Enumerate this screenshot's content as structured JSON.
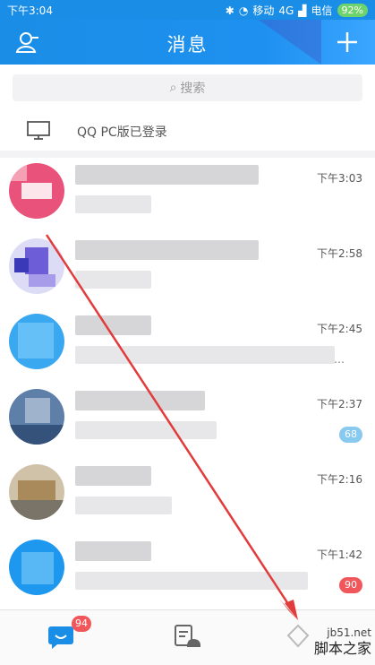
{
  "status": {
    "time": "下午3:04",
    "carrier1": "移动",
    "network": "4G",
    "carrier2": "电信",
    "battery": "92%"
  },
  "header": {
    "title": "消息"
  },
  "search": {
    "placeholder": "搜索"
  },
  "pc_login": {
    "text": "QQ PC版已登录"
  },
  "conversations": [
    {
      "time": "下午3:03",
      "badge": ""
    },
    {
      "time": "下午2:58",
      "badge": ""
    },
    {
      "time": "下午2:45",
      "badge": ""
    },
    {
      "time": "下午2:37",
      "badge": "68"
    },
    {
      "time": "下午2:16",
      "badge": ""
    },
    {
      "time": "下午1:42",
      "badge": "90"
    }
  ],
  "tabbar": {
    "messages_badge": "94"
  },
  "watermark": {
    "site": "jb51.net",
    "brand": "脚本之家"
  },
  "colors": {
    "accent": "#1a8ee6",
    "badge_red": "#f0565a",
    "badge_blue": "#87c9ef",
    "annotation_arrow": "#e23b3b"
  }
}
